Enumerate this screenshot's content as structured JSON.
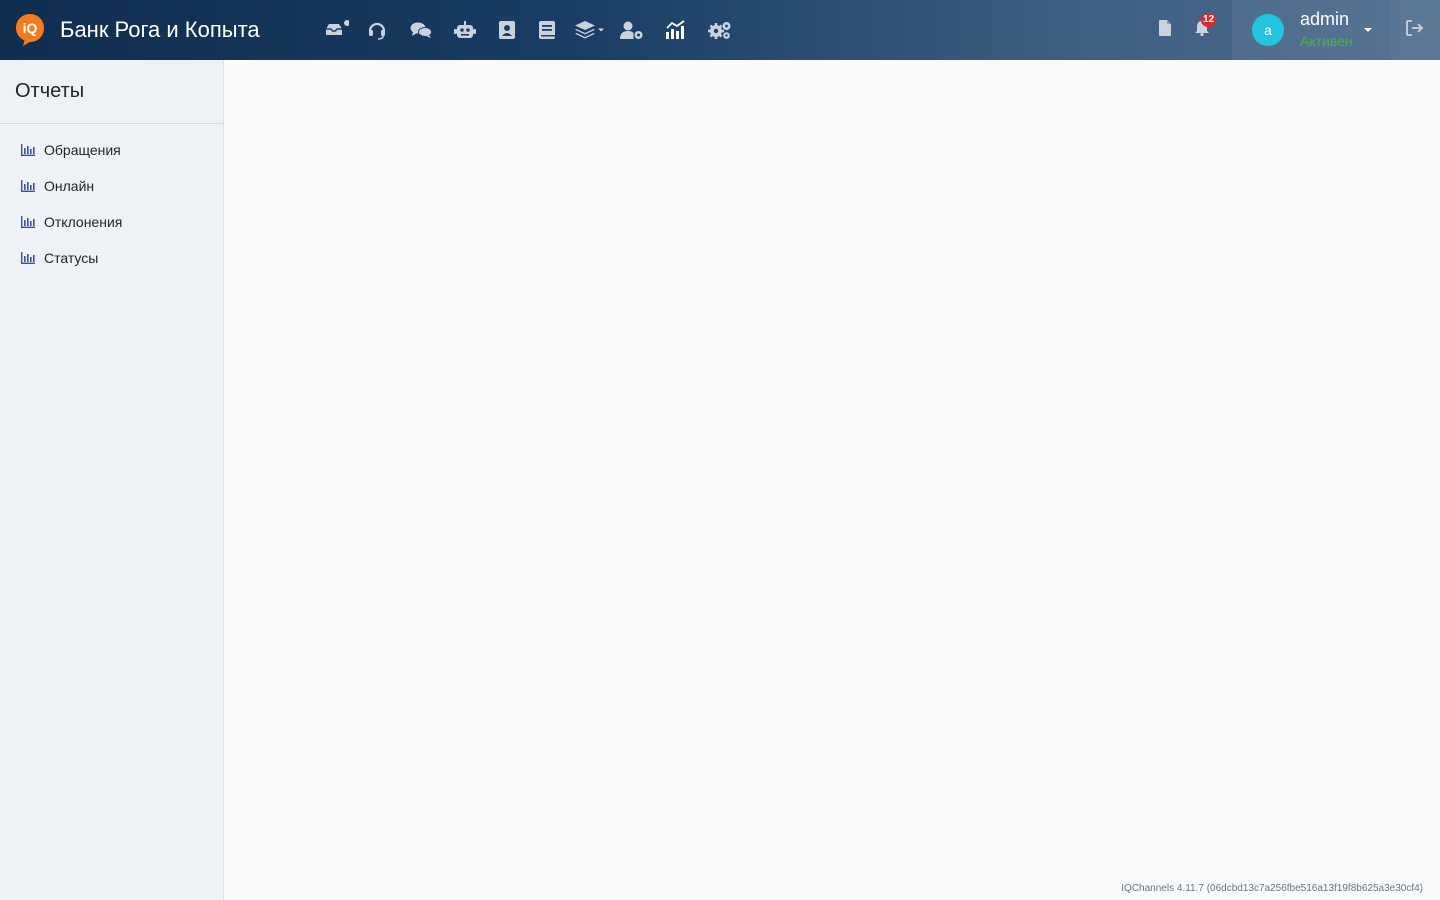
{
  "header": {
    "brand": "Банк Рога и Копыта",
    "logo_text": "iQ",
    "nav_icons": [
      "inbox-icon",
      "headset-icon",
      "chats-icon",
      "robot-icon",
      "contacts-icon",
      "book-icon",
      "layers-icon",
      "user-settings-icon",
      "analytics-icon",
      "settings-icon"
    ],
    "notifications_count": "12",
    "user": {
      "avatar_letter": "a",
      "name": "admin",
      "status": "Активен"
    },
    "colors": {
      "status": "#4caf50",
      "badge": "#e3262b",
      "avatar": "#22c5dd",
      "logo": "#f47b20"
    }
  },
  "sidebar": {
    "title": "Отчеты",
    "items": [
      {
        "label": "Обращения",
        "icon": "chart-bar-icon"
      },
      {
        "label": "Онлайн",
        "icon": "chart-bar-icon"
      },
      {
        "label": "Отклонения",
        "icon": "chart-bar-icon"
      },
      {
        "label": "Статусы",
        "icon": "chart-bar-icon"
      }
    ]
  },
  "footer": {
    "version": "IQChannels 4.11.7 (06dcbd13c7a256fbe516a13f19f8b625a3e30cf4)"
  }
}
